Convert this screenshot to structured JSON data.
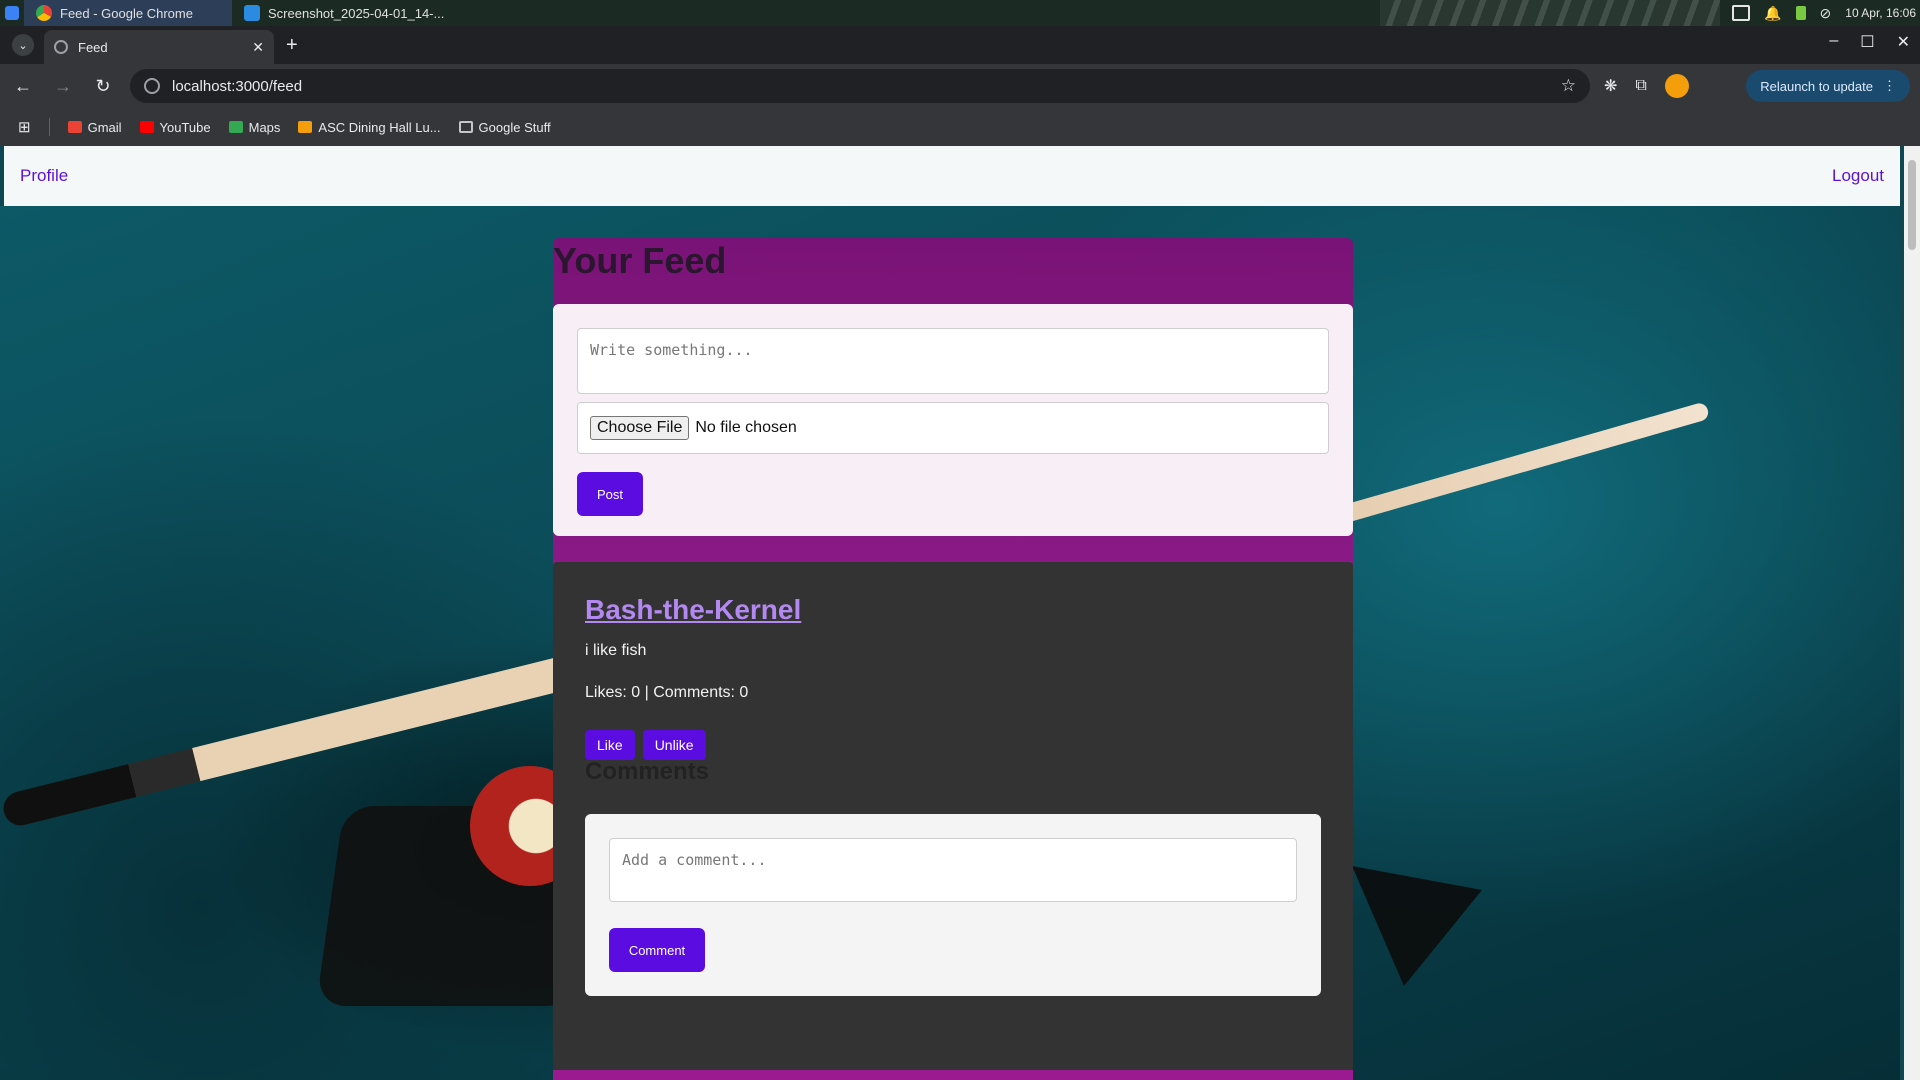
{
  "taskbar": {
    "tasks": [
      {
        "label": "Feed - Google Chrome"
      },
      {
        "label": "Screenshot_2025-04-01_14-..."
      }
    ],
    "clock": "10 Apr, 16:06"
  },
  "browser": {
    "tab_title": "Feed",
    "url": "localhost:3000/feed",
    "relaunch_label": "Relaunch to update",
    "bookmarks": [
      {
        "label": "Gmail",
        "icon": "gmail-icon"
      },
      {
        "label": "YouTube",
        "icon": "youtube-icon"
      },
      {
        "label": "Maps",
        "icon": "maps-icon"
      },
      {
        "label": "ASC Dining Hall Lu...",
        "icon": "dining-icon"
      },
      {
        "label": "Google Stuff",
        "icon": "folder-icon"
      }
    ]
  },
  "page": {
    "nav": {
      "profile": "Profile",
      "logout": "Logout"
    },
    "feed_title": "Your Feed",
    "post_form": {
      "placeholder": "Write something...",
      "choose_file": "Choose File",
      "file_status": "No file chosen",
      "post_button": "Post"
    },
    "posts": [
      {
        "author": "Bash-the-Kernel",
        "text": "i like fish",
        "stats": "Likes: 0 | Comments: 0",
        "like": "Like",
        "unlike": "Unlike",
        "comments_heading": "Comments",
        "comment_placeholder": "Add a comment...",
        "comment_button": "Comment"
      }
    ]
  },
  "colors": {
    "accent": "#5b0ce0",
    "feed_bg": "#7a1377",
    "card_bg": "#333333",
    "author_link": "#b388f0"
  }
}
